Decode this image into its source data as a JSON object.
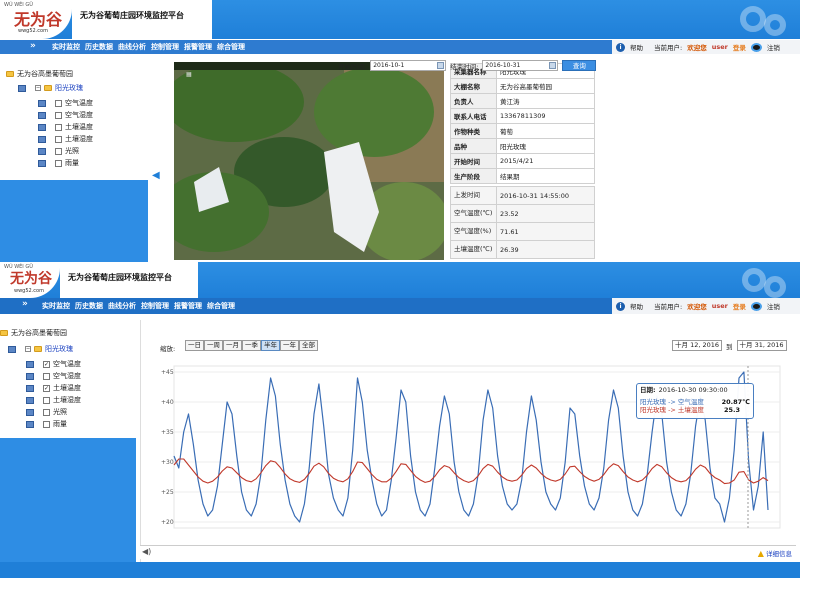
{
  "app": {
    "site_title": "无为谷葡萄庄园环境监控平台",
    "logo_text": "无为谷",
    "logo_pinyin": "WÚ WÉI GǓ",
    "logo_url": "wwg52.com"
  },
  "nav": {
    "items": [
      "实时监控",
      "历史数据",
      "曲线分析",
      "控制管理",
      "报警管理",
      "综合管理"
    ],
    "help": "帮助",
    "current_user_label": "当前用户:",
    "welcome": "欢迎您",
    "username": "user",
    "login": "登录",
    "logout": "注销"
  },
  "tree": {
    "root": "无为谷高墨葡萄园",
    "node": "阳光玫瑰",
    "items": [
      {
        "label": "空气温度",
        "checked": false
      },
      {
        "label": "空气湿度",
        "checked": false
      },
      {
        "label": "土壤温度",
        "checked": false
      },
      {
        "label": "土壤湿度",
        "checked": false
      },
      {
        "label": "光照",
        "checked": false
      },
      {
        "label": "雨量",
        "checked": false
      }
    ],
    "items2": [
      {
        "label": "空气温度",
        "checked": true
      },
      {
        "label": "空气湿度",
        "checked": false
      },
      {
        "label": "土壤温度",
        "checked": true
      },
      {
        "label": "土壤湿度",
        "checked": false
      },
      {
        "label": "光照",
        "checked": false
      },
      {
        "label": "雨量",
        "checked": false
      }
    ]
  },
  "info": {
    "rows": [
      {
        "k": "采集器名称",
        "v": "阳光玫瑰"
      },
      {
        "k": "大棚名称",
        "v": "无为谷高墨葡萄园"
      },
      {
        "k": "负责人",
        "v": "黄江涛"
      },
      {
        "k": "联系人电话",
        "v": "13367811309"
      },
      {
        "k": "作物种类",
        "v": "葡萄"
      },
      {
        "k": "品种",
        "v": "阳光玫瑰"
      },
      {
        "k": "开始时间",
        "v": "2015/4/21"
      },
      {
        "k": "生产阶段",
        "v": "结果期"
      }
    ],
    "sensors": [
      {
        "k": "上发时间",
        "v": "2016-10-31 14:55:00"
      },
      {
        "k": "空气温度(℃)",
        "v": "23.52"
      },
      {
        "k": "空气湿度(%)",
        "v": "71.61"
      },
      {
        "k": "土壤温度(℃)",
        "v": "26.39"
      }
    ]
  },
  "query": {
    "start_label": "开始时间:",
    "start_value": "2016-10-1",
    "end_label": "结束时间:",
    "end_value": "2016-10-31",
    "button": "查询"
  },
  "zoom": {
    "label": "缩放:",
    "buttons": [
      "一日",
      "一周",
      "一月",
      "一季",
      "半年",
      "一年",
      "全部"
    ],
    "active": "半年",
    "range_from": "十月 12, 2016",
    "range_to_label": "到",
    "range_to": "十月 31, 2016"
  },
  "tooltip": {
    "date_label": "日期:",
    "date_value": "2016-10-30 09:30:00",
    "row1_name": "阳光玫瑰 -> 空气温度",
    "row1_value": "20.87℃",
    "row2_name": "阳光玫瑰 -> 土壤温度",
    "row2_value": "25.3"
  },
  "status": {
    "detail": "详细信息"
  },
  "colors": {
    "header_blue": "#1f7fd8",
    "air_temp_line": "#3a6db5",
    "soil_temp_line": "#c0392b"
  },
  "chart_data": {
    "type": "line",
    "title": "",
    "xlabel": "",
    "ylabel": "",
    "ylim": [
      19,
      46
    ],
    "yticks": [
      20,
      25,
      30,
      35,
      40,
      45
    ],
    "ytick_labels": [
      "+20",
      "+25",
      "+30",
      "+35",
      "+40",
      "+45"
    ],
    "series": [
      {
        "name": "阳光玫瑰 -> 空气温度",
        "color": "#3a6db5",
        "values": [
          31,
          29,
          35,
          38,
          33,
          27,
          23,
          21,
          22,
          26,
          33,
          40,
          38,
          31,
          25,
          22,
          21,
          23,
          28,
          37,
          44,
          41,
          33,
          27,
          23,
          21,
          20,
          23,
          29,
          38,
          43,
          36,
          28,
          24,
          22,
          21,
          24,
          32,
          44,
          40,
          32,
          27,
          23,
          21,
          22,
          27,
          34,
          42,
          40,
          31,
          25,
          22,
          21,
          23,
          29,
          36,
          41,
          38,
          30,
          25,
          22,
          21,
          23,
          28,
          37,
          42,
          39,
          31,
          26,
          23,
          22,
          23,
          27,
          35,
          41,
          37,
          30,
          25,
          23,
          22,
          24,
          30,
          39,
          38,
          31,
          26,
          23,
          22,
          24,
          29,
          37,
          42,
          39,
          31,
          25,
          22,
          21,
          23,
          28,
          35,
          41,
          38,
          30,
          25,
          22,
          21,
          23,
          28,
          36,
          41,
          37,
          29,
          24,
          23,
          20,
          24,
          32,
          44,
          45,
          30,
          22,
          26,
          35,
          22
        ]
      },
      {
        "name": "阳光玫瑰 -> 土壤温度",
        "color": "#c0392b",
        "values": [
          29.5,
          30.5,
          30.5,
          29.5,
          28.5,
          27.5,
          26.8,
          26.5,
          26.8,
          27.5,
          28.5,
          29.2,
          29.0,
          28.2,
          27.4,
          26.9,
          26.7,
          27.2,
          28.2,
          29.4,
          30.2,
          30.0,
          29.1,
          28.0,
          27.2,
          26.8,
          26.6,
          27.1,
          28.1,
          29.3,
          29.8,
          29.2,
          28.1,
          27.3,
          26.9,
          26.7,
          27.2,
          28.4,
          30.0,
          29.9,
          28.9,
          27.9,
          27.1,
          26.7,
          26.7,
          27.3,
          28.4,
          29.7,
          29.6,
          28.6,
          27.6,
          27.0,
          26.6,
          26.8,
          27.6,
          28.7,
          29.4,
          29.1,
          28.2,
          27.4,
          26.9,
          26.6,
          26.9,
          27.7,
          28.9,
          29.6,
          29.3,
          28.3,
          27.5,
          27.0,
          26.8,
          27.0,
          27.8,
          28.9,
          29.5,
          29.0,
          28.1,
          27.4,
          27.0,
          26.8,
          27.1,
          28.0,
          29.2,
          29.3,
          28.4,
          27.6,
          27.1,
          26.8,
          27.1,
          27.9,
          29.0,
          29.7,
          29.4,
          28.4,
          27.5,
          27.0,
          26.7,
          27.0,
          27.8,
          28.9,
          29.6,
          29.2,
          28.2,
          27.4,
          26.9,
          26.7,
          26.9,
          27.7,
          28.8,
          29.5,
          29.1,
          28.1,
          27.4,
          27.0,
          26.4,
          26.5,
          27.0,
          28.3,
          28.4,
          27.0,
          26.5,
          26.8,
          27.4,
          26.9
        ]
      }
    ]
  }
}
